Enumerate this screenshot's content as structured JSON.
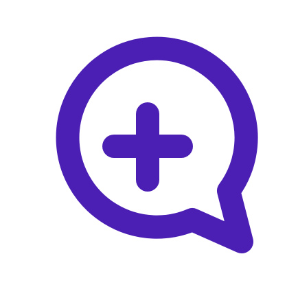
{
  "icon": {
    "name": "chat-bubble-plus-icon",
    "color": "#4b1fb4",
    "background": "#ffffff"
  }
}
